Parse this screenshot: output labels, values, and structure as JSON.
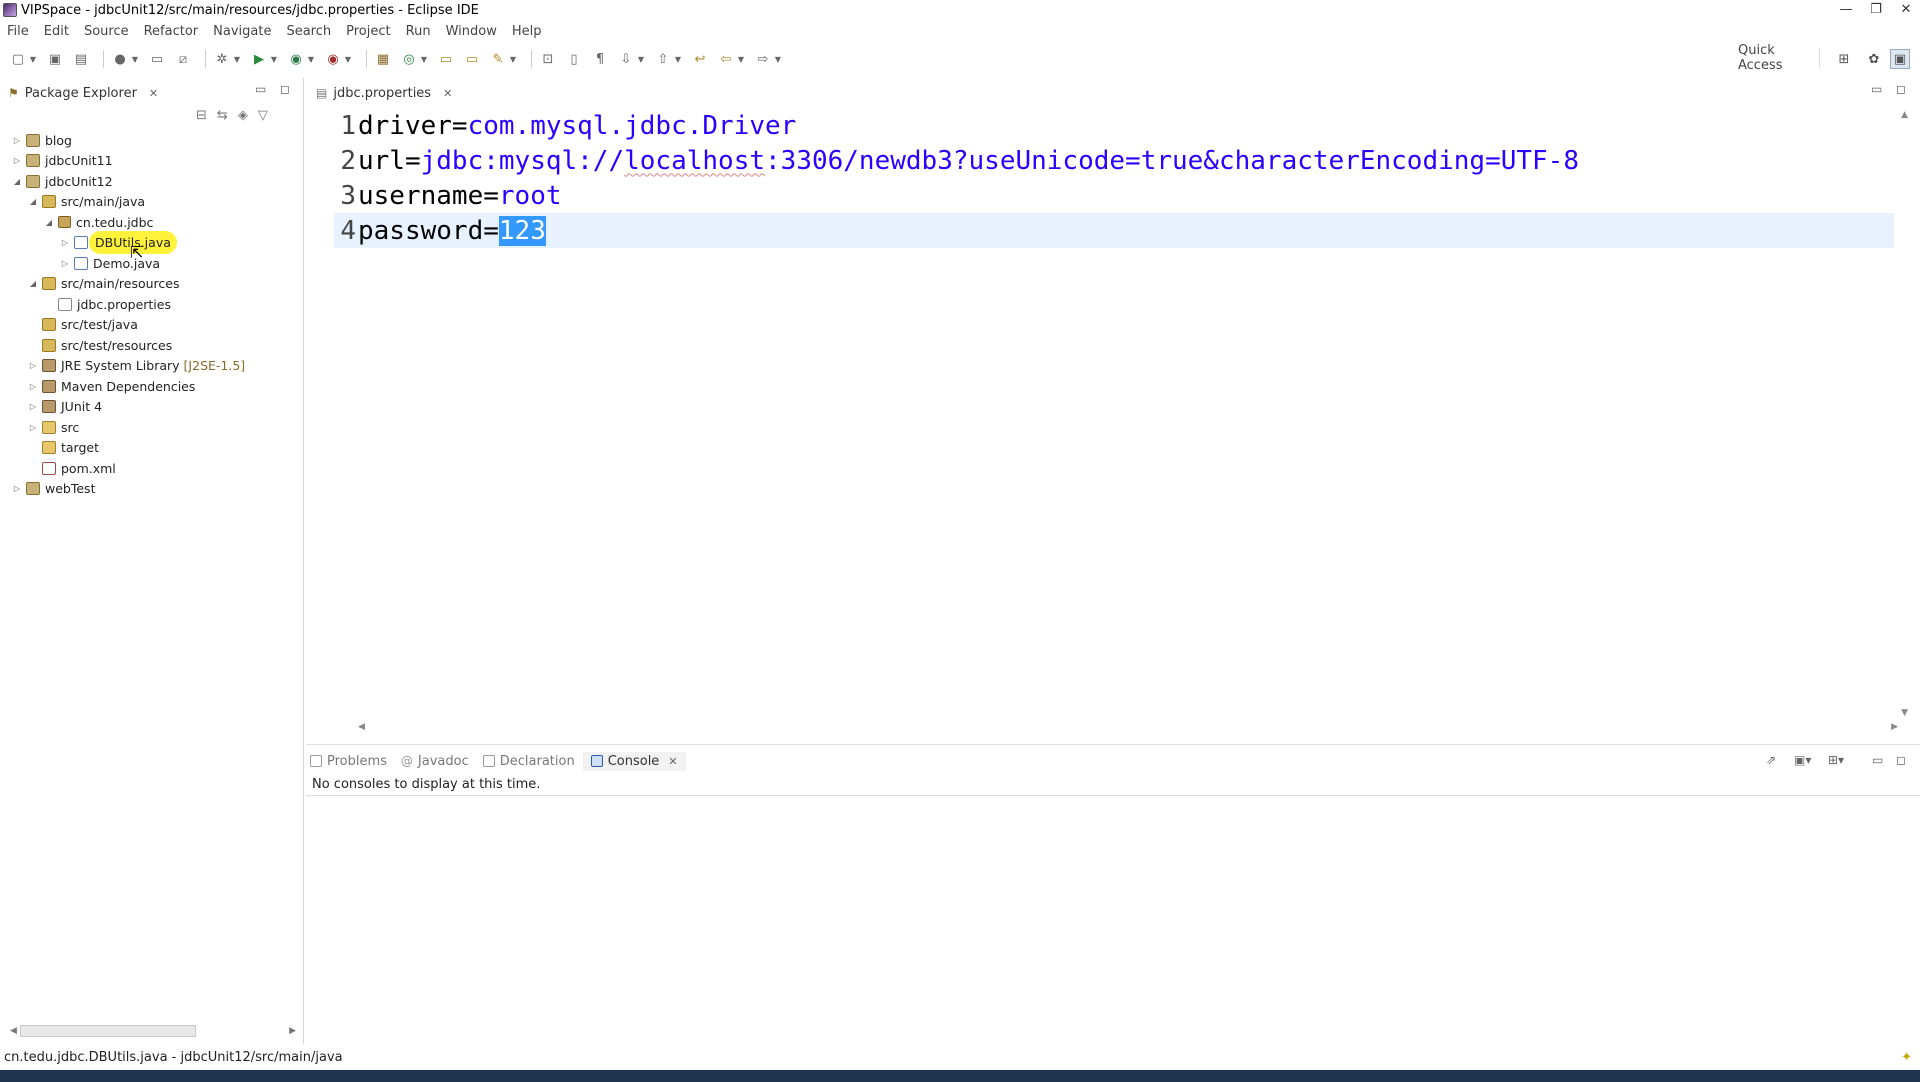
{
  "window": {
    "title": "VIPSpace - jdbcUnit12/src/main/resources/jdbc.properties - Eclipse IDE",
    "controls": [
      "—",
      "❐",
      "✕"
    ]
  },
  "menu": [
    "File",
    "Edit",
    "Source",
    "Refactor",
    "Navigate",
    "Search",
    "Project",
    "Run",
    "Window",
    "Help"
  ],
  "toolbar": {
    "quick_access": "Quick Access"
  },
  "package_explorer": {
    "tab_label": "Package Explorer",
    "tree": [
      {
        "label": "blog",
        "depth": 0,
        "twisty": "▷",
        "icon": "project"
      },
      {
        "label": "jdbcUnit11",
        "depth": 0,
        "twisty": "▷",
        "icon": "project"
      },
      {
        "label": "jdbcUnit12",
        "depth": 0,
        "twisty": "◢",
        "icon": "project"
      },
      {
        "label": "src/main/java",
        "depth": 1,
        "twisty": "◢",
        "icon": "srcfolder"
      },
      {
        "label": "cn.tedu.jdbc",
        "depth": 2,
        "twisty": "◢",
        "icon": "package"
      },
      {
        "label": "DBUtils.java",
        "depth": 3,
        "twisty": "▷",
        "icon": "java",
        "highlight": true
      },
      {
        "label": "Demo.java",
        "depth": 3,
        "twisty": "▷",
        "icon": "java"
      },
      {
        "label": "src/main/resources",
        "depth": 1,
        "twisty": "◢",
        "icon": "srcfolder"
      },
      {
        "label": "jdbc.properties",
        "depth": 2,
        "twisty": "",
        "icon": "file"
      },
      {
        "label": "src/test/java",
        "depth": 1,
        "twisty": "",
        "icon": "srcfolder"
      },
      {
        "label": "src/test/resources",
        "depth": 1,
        "twisty": "",
        "icon": "srcfolder"
      },
      {
        "label": "JRE System Library",
        "depth": 1,
        "twisty": "▷",
        "icon": "lib",
        "suffix": "[J2SE-1.5]"
      },
      {
        "label": "Maven Dependencies",
        "depth": 1,
        "twisty": "▷",
        "icon": "lib"
      },
      {
        "label": "JUnit 4",
        "depth": 1,
        "twisty": "▷",
        "icon": "lib"
      },
      {
        "label": "src",
        "depth": 1,
        "twisty": "▷",
        "icon": "folder"
      },
      {
        "label": "target",
        "depth": 1,
        "twisty": "",
        "icon": "folder"
      },
      {
        "label": "pom.xml",
        "depth": 1,
        "twisty": "",
        "icon": "xml"
      },
      {
        "label": "webTest",
        "depth": 0,
        "twisty": "▷",
        "icon": "project"
      }
    ]
  },
  "editor": {
    "tab_label": "jdbc.properties",
    "lines": [
      {
        "num": "1",
        "key": "driver=",
        "value": "com.mysql.jdbc.Driver"
      },
      {
        "num": "2",
        "key": "url=",
        "value_a": "jdbc:mysql://",
        "value_b": "localhost",
        "value_c": ":3306/newdb3?useUnicode=true&characterEncoding=UTF-8"
      },
      {
        "num": "3",
        "key": "username=",
        "value": "root"
      },
      {
        "num": "4",
        "key": "password=",
        "value": "123"
      }
    ]
  },
  "bottom": {
    "tabs": [
      {
        "label": "Problems"
      },
      {
        "label": "Javadoc"
      },
      {
        "label": "Declaration"
      },
      {
        "label": "Console",
        "active": true
      }
    ],
    "console_message": "No consoles to display at this time."
  },
  "status": {
    "text": "cn.tedu.jdbc.DBUtils.java - jdbcUnit12/src/main/java"
  }
}
